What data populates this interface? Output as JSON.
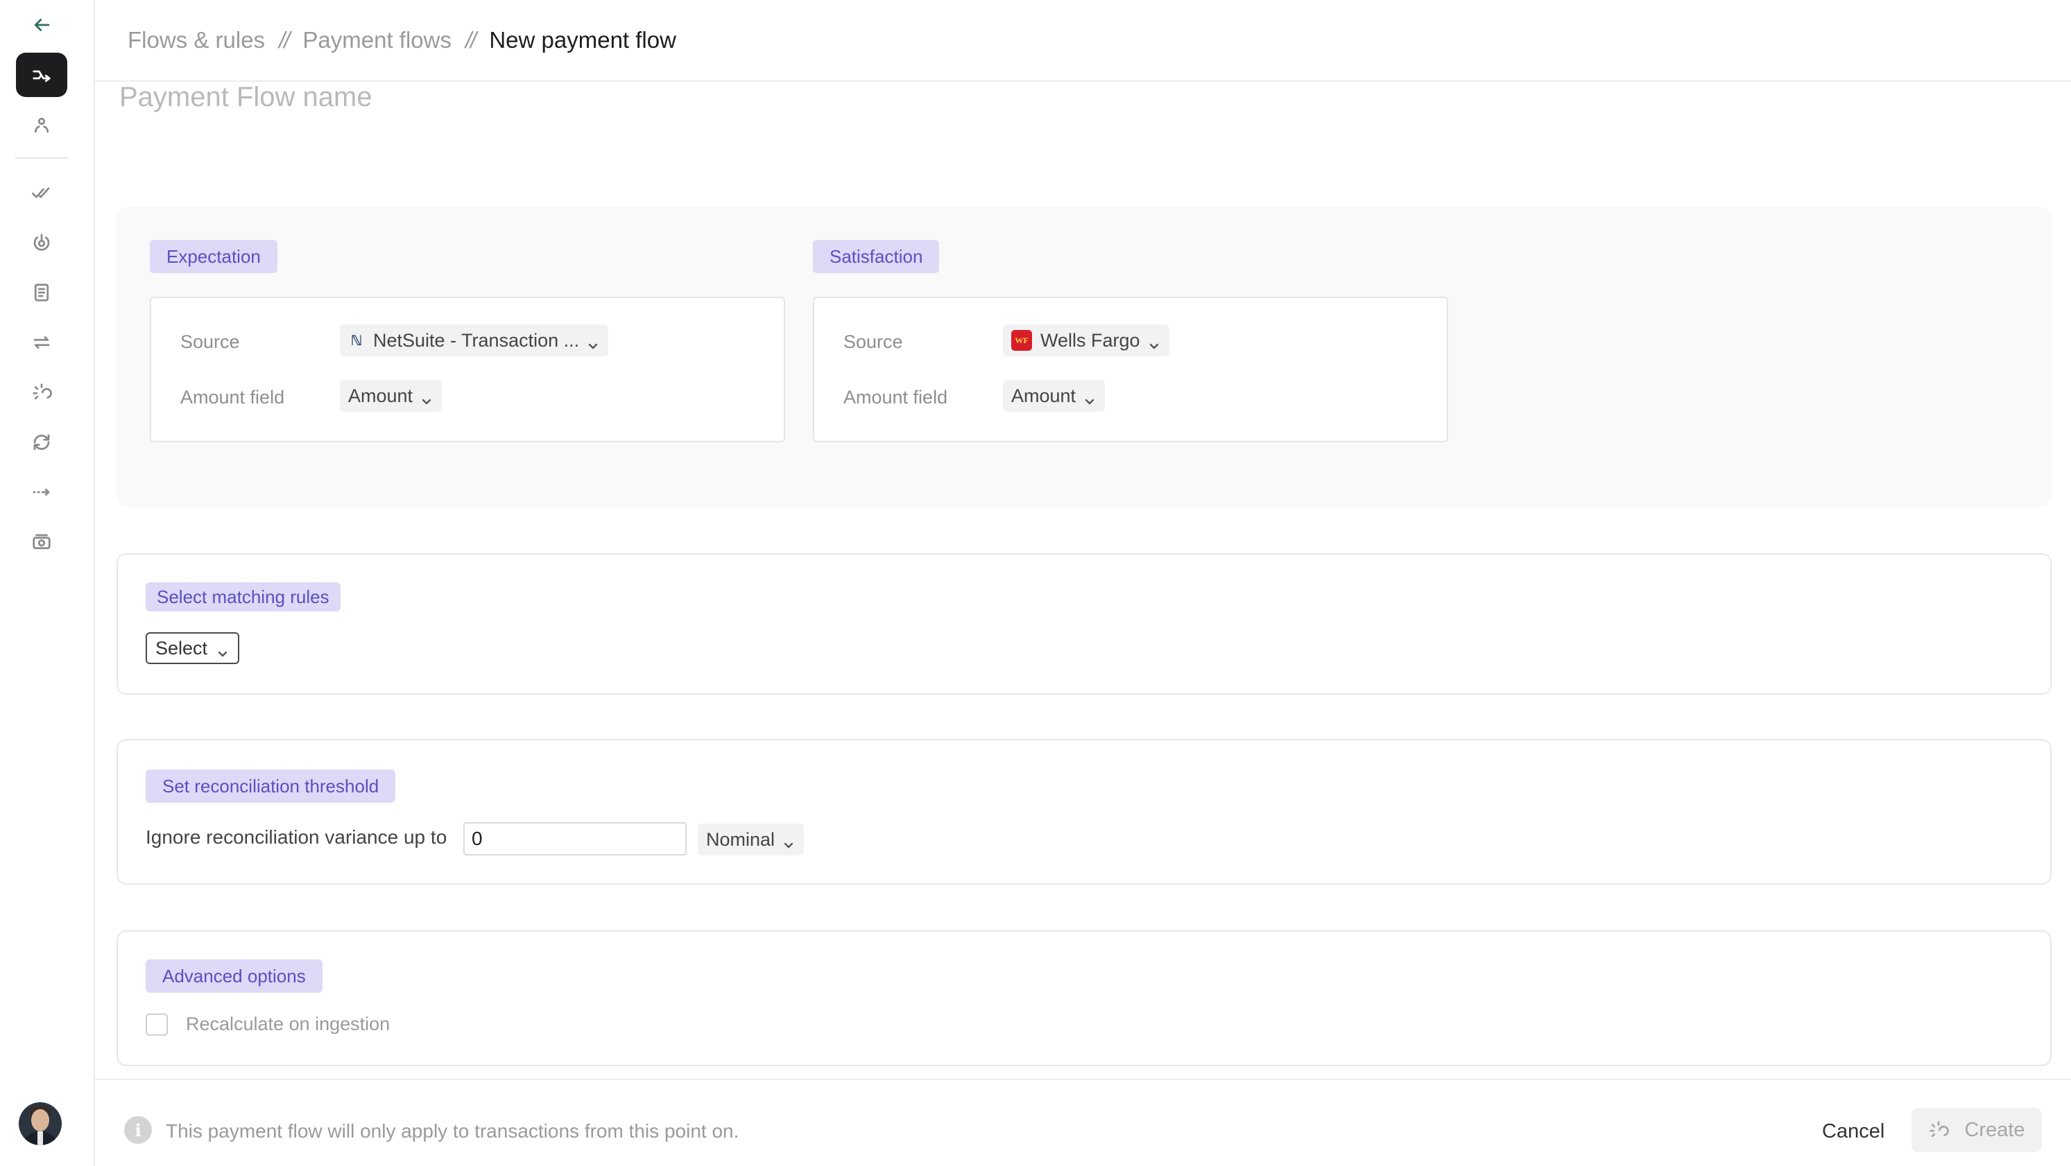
{
  "breadcrumb": {
    "items": [
      "Flows & rules",
      "Payment flows"
    ],
    "separator": "//",
    "current": "New payment flow"
  },
  "form": {
    "flow_name_placeholder": "Payment Flow name"
  },
  "expectation": {
    "label": "Expectation",
    "source_label": "Source",
    "source_value": "NetSuite - Transaction ...",
    "source_icon": "netsuite-icon",
    "amount_label": "Amount field",
    "amount_value": "Amount"
  },
  "satisfaction": {
    "label": "Satisfaction",
    "source_label": "Source",
    "source_value": "Wells Fargo",
    "source_icon": "wells-fargo-icon",
    "source_icon_text": "WF",
    "amount_label": "Amount field",
    "amount_value": "Amount"
  },
  "matching": {
    "label": "Select matching rules",
    "select_value": "Select"
  },
  "threshold": {
    "label": "Set reconciliation threshold",
    "text": "Ignore reconciliation variance up to",
    "value": "0",
    "unit": "Nominal"
  },
  "advanced": {
    "label": "Advanced options",
    "recalc_label": "Recalculate on ingestion",
    "recalc_checked": false
  },
  "footer": {
    "info_glyph": "i",
    "info": "This payment flow will only apply to transactions from this point on.",
    "cancel": "Cancel",
    "create": "Create"
  },
  "colors": {
    "accent_pill_bg": "#ddd9f6",
    "accent_pill_text": "#5b4fc0",
    "sidebar_active": "#1d1d1f"
  }
}
